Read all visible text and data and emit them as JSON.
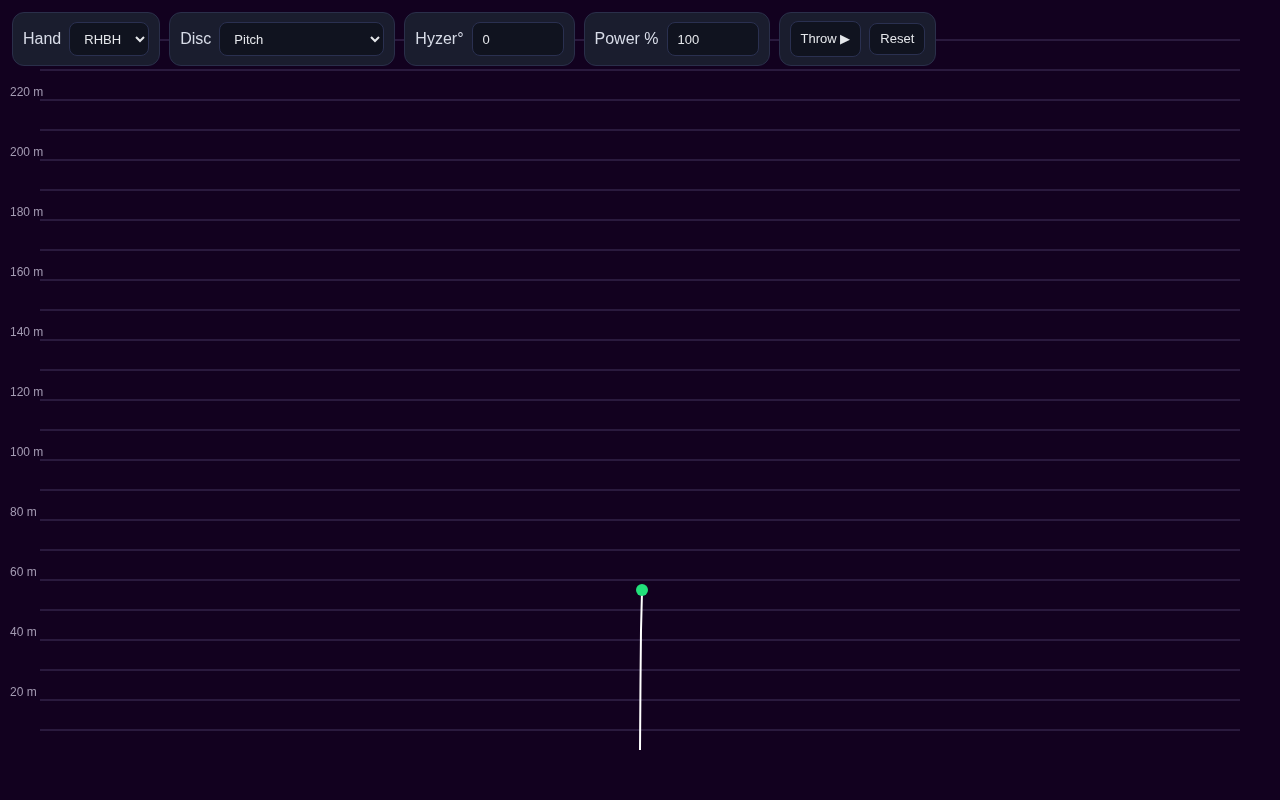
{
  "controls": [
    {
      "kind": "select",
      "label": "Hand",
      "value": "RHBH"
    },
    {
      "kind": "select",
      "label": "Disc",
      "value": "Pitch"
    },
    {
      "kind": "input",
      "label": "Hyzer°",
      "value": "0"
    },
    {
      "kind": "input",
      "label": "Power %",
      "value": "100"
    }
  ],
  "buttons": [
    "Throw ▶",
    "Reset"
  ],
  "field": {
    "distance_labels": [
      "220 m",
      "200 m",
      "180 m",
      "160 m",
      "140 m",
      "120 m",
      "100 m",
      "80 m",
      "60 m",
      "40 m",
      "20 m"
    ]
  }
}
